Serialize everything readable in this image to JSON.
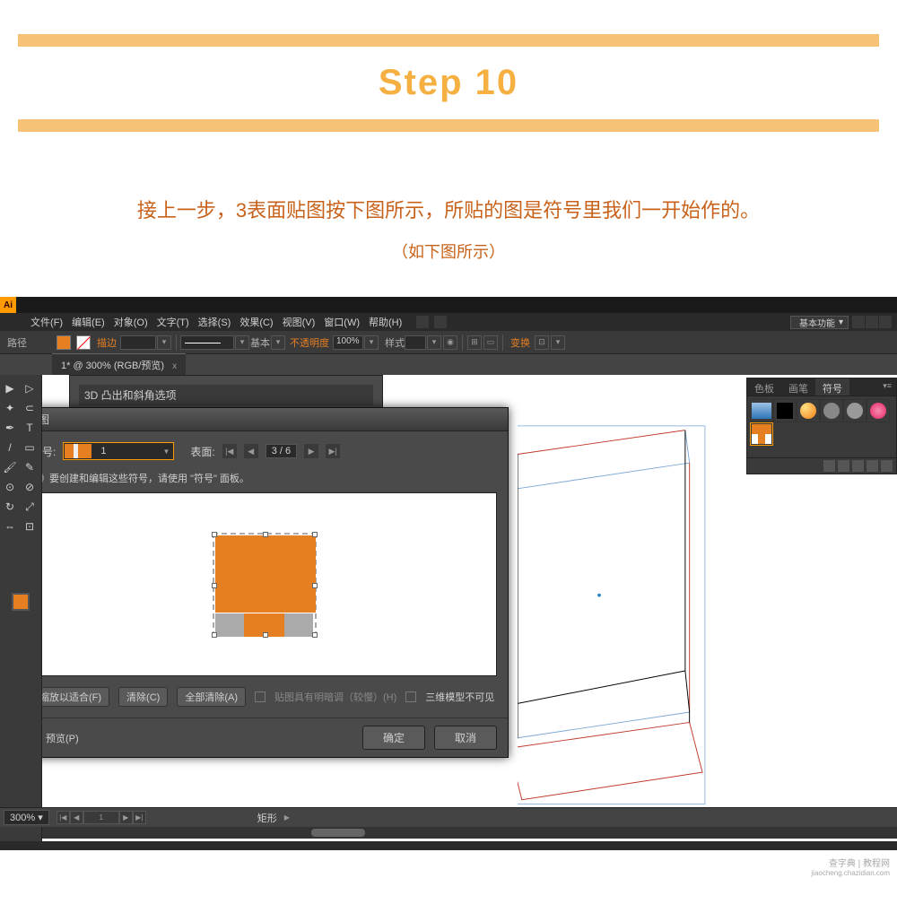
{
  "header": {
    "step_title": "Step 10",
    "description": "接上一步，3表面贴图按下图所示，所贴的图是符号里我们一开始作的。",
    "sub_description": "（如下图所示）"
  },
  "app": {
    "logo": "Ai",
    "menu": {
      "file": "文件(F)",
      "edit": "编辑(E)",
      "object": "对象(O)",
      "type": "文字(T)",
      "select": "选择(S)",
      "effect": "效果(C)",
      "view": "视图(V)",
      "window": "窗口(W)",
      "help": "帮助(H)"
    },
    "workspace": "基本功能",
    "controlbar": {
      "path": "路径",
      "stroke_label": "描边",
      "stroke_value": "",
      "brush_label": "基本",
      "opacity_label": "不透明度",
      "opacity_value": "100%",
      "style_label": "样式",
      "transform_label": "变换"
    },
    "tab": {
      "name": "1* @ 300% (RGB/预览)",
      "close": "x"
    },
    "dialog3d": {
      "title": "3D 凸出和斜角选项"
    },
    "mapdialog": {
      "title": "贴图",
      "symbol_label": "符号:",
      "symbol_value": "1",
      "surface_label": "表面:",
      "surface_value": "3 / 6",
      "info": "要创建和编辑这些符号，请使用 \"符号\" 面板。",
      "fit_btn": "缩放以适合(F)",
      "clear_btn": "清除(C)",
      "clear_all_btn": "全部清除(A)",
      "shading_label": "贴图具有明暗调（较慢）(H)",
      "invisible_label": "三维模型不可见",
      "preview_label": "预览(P)",
      "ok": "确定",
      "cancel": "取消"
    },
    "panels": {
      "swatches": "色板",
      "brushes": "画笔",
      "symbols": "符号"
    },
    "status": {
      "zoom": "300%",
      "page": "1",
      "object": "矩形"
    }
  },
  "watermark": {
    "line1": "查字典 | 教程网",
    "line2": "jiaocheng.chazidian.com"
  }
}
